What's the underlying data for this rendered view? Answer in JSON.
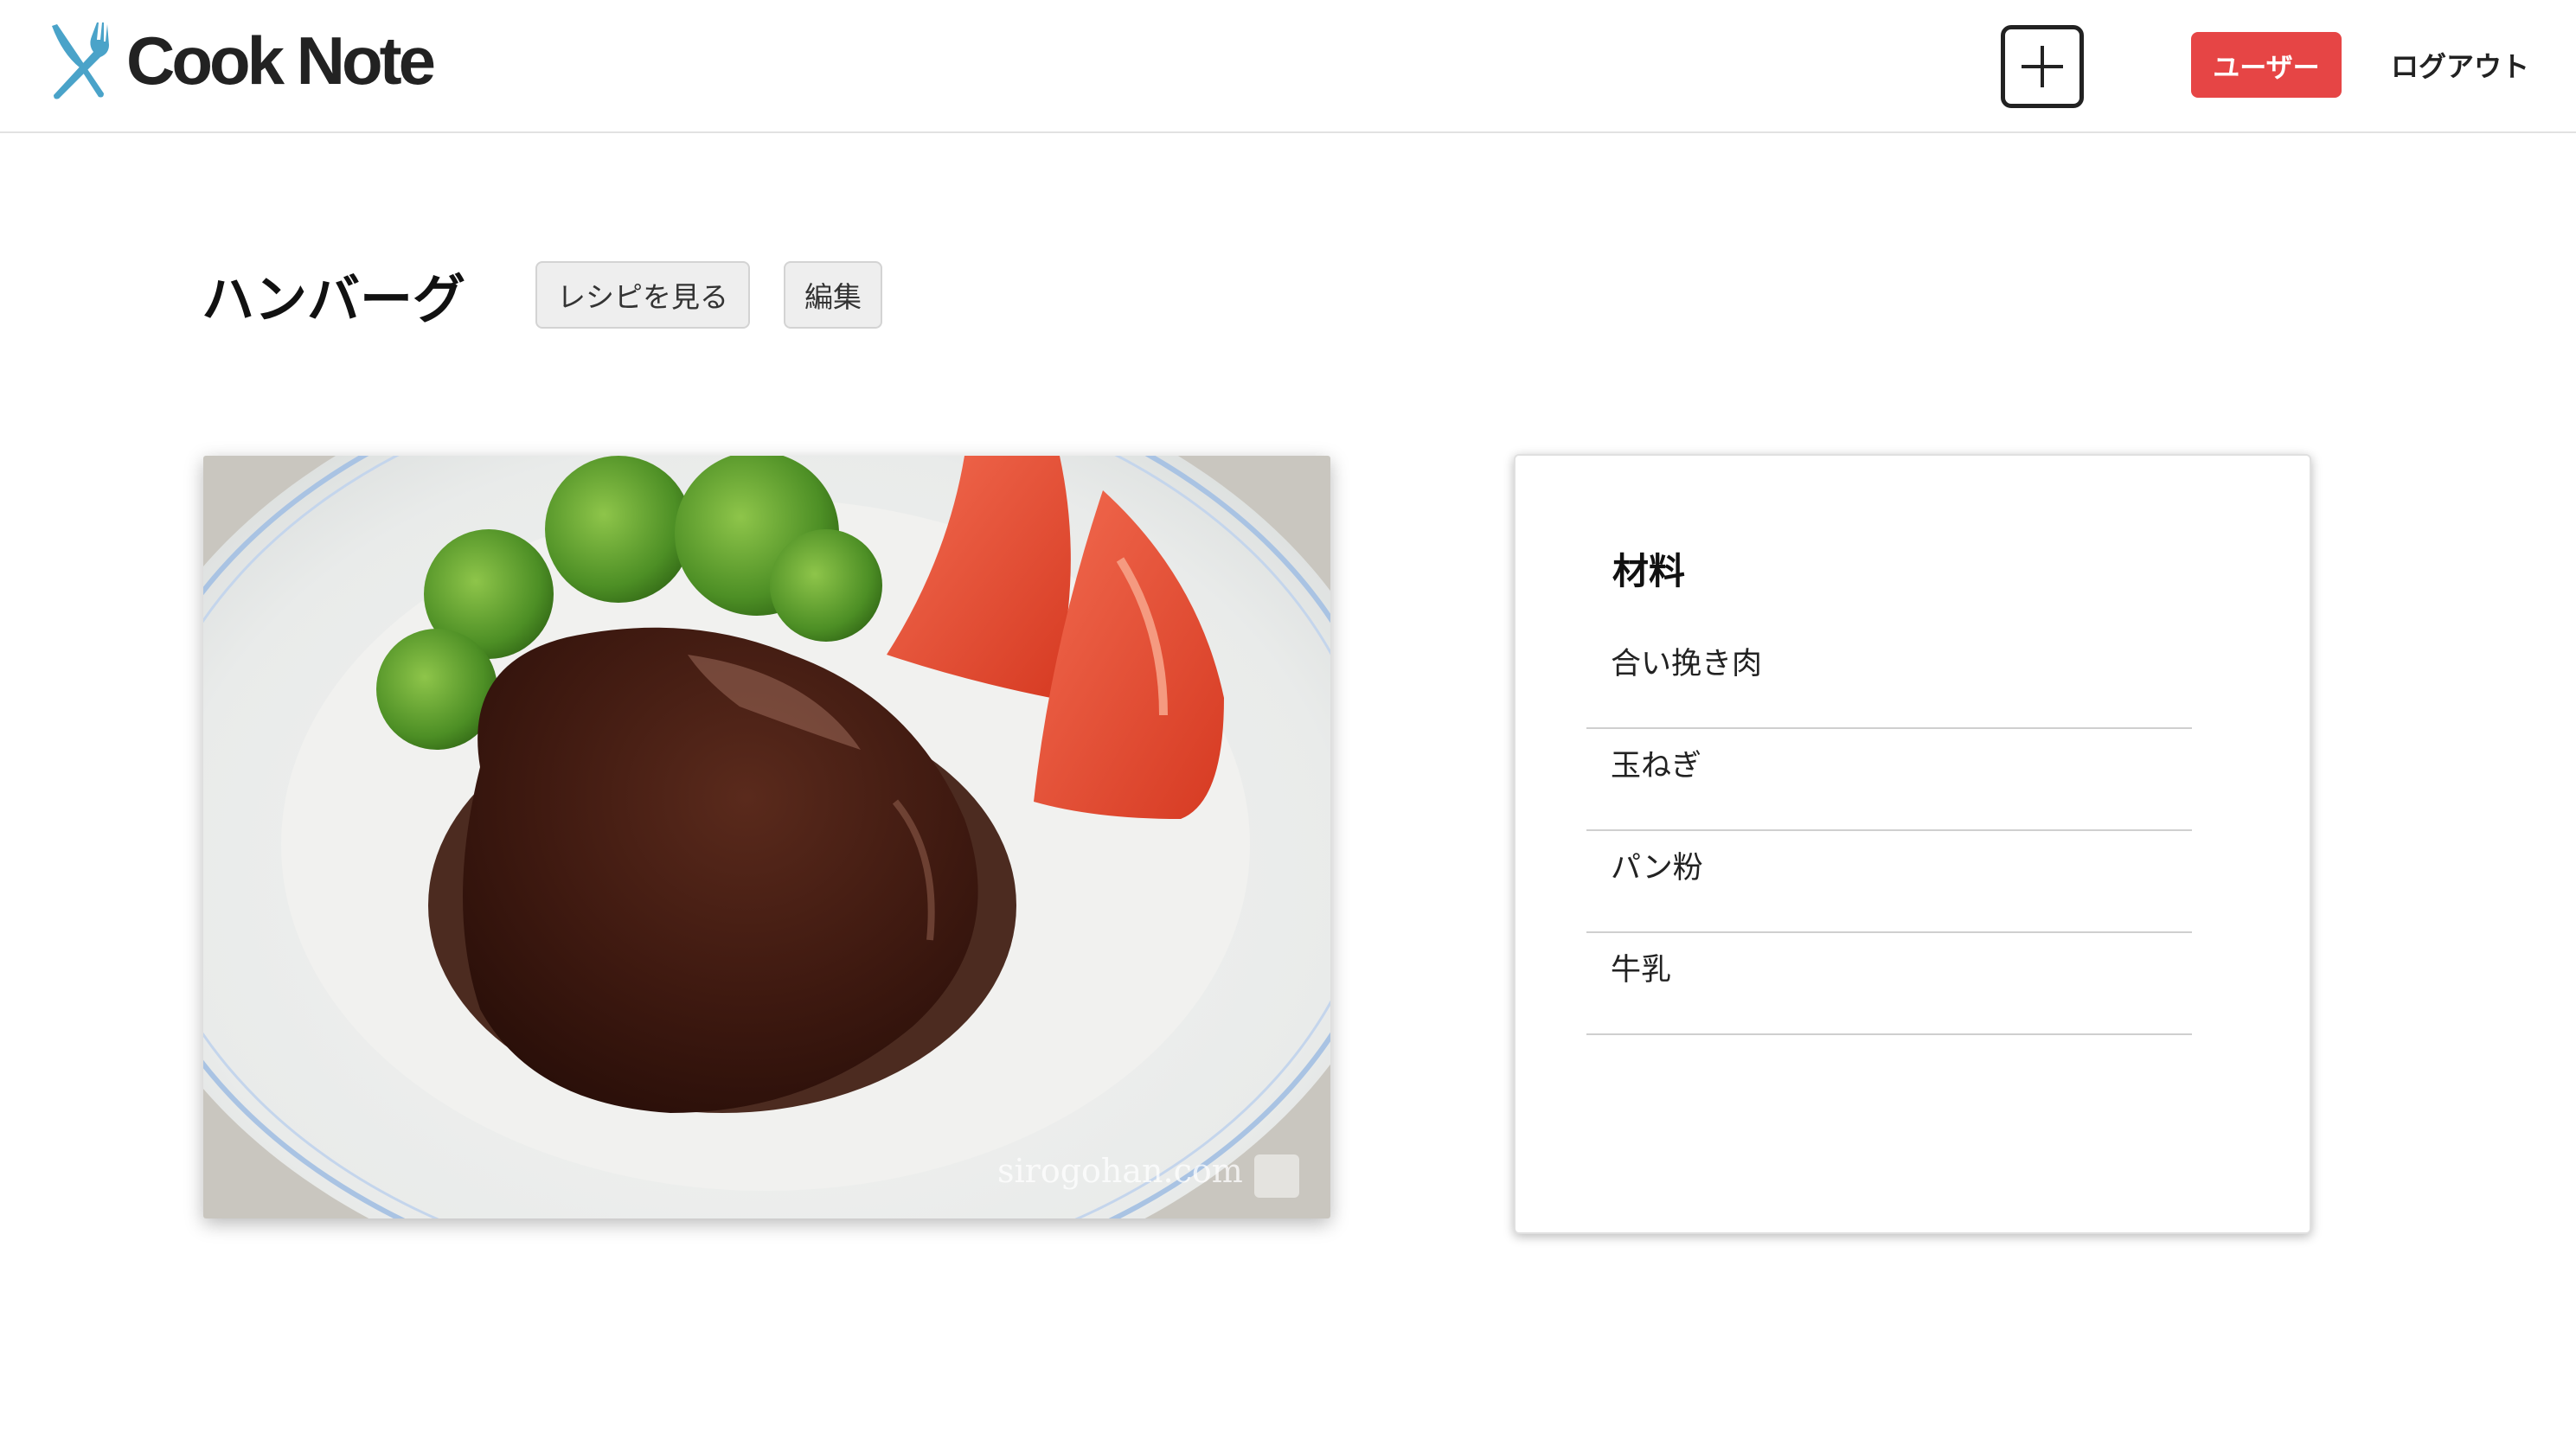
{
  "app": {
    "logo_text": "Cook Note",
    "logo_icon": "fork-knife-icon",
    "accent_color": "#4aa3c9"
  },
  "header": {
    "add_button_icon": "plus-icon",
    "user_button_label": "ユーザー",
    "user_button_color": "#e64545",
    "logout_label": "ログアウト"
  },
  "recipe": {
    "title": "ハンバーグ",
    "view_recipe_label": "レシピを見る",
    "edit_label": "編集",
    "photo_watermark": "sirogohan.com"
  },
  "ingredients": {
    "title": "材料",
    "items": [
      "合い挽き肉",
      "玉ねぎ",
      "パン粉",
      "牛乳"
    ]
  }
}
